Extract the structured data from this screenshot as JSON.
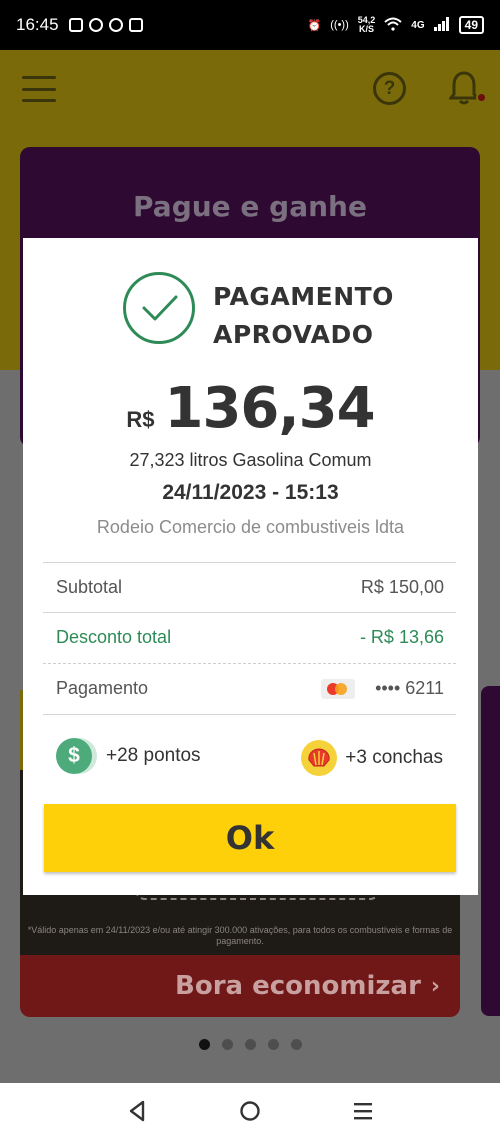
{
  "status_bar": {
    "time": "16:45",
    "net_speed_value": "54,2",
    "net_speed_unit": "K/S",
    "network": "4G",
    "battery": "49"
  },
  "background_app": {
    "promo_title": "Pague e ganhe",
    "disclaimer": "*Válido apenas em 24/11/2023 e/ou até atingir 300.000 ativações, para todos os combustíveis e formas de pagamento.",
    "cta_label": "Bora economizar",
    "carousel_pages": 5,
    "carousel_active": 0
  },
  "receipt": {
    "title_line1": "PAGAMENTO",
    "title_line2": "APROVADO",
    "currency": "R$",
    "amount": "136,34",
    "liters": "27,323 litros Gasolina Comum",
    "datetime": "24/11/2023 - 15:13",
    "merchant": "Rodeio Comercio de combustiveis ldta",
    "subtotal_label": "Subtotal",
    "subtotal_value": "R$ 150,00",
    "discount_label": "Desconto total",
    "discount_value": "- R$ 13,66",
    "payment_label": "Pagamento",
    "card_masked": "•••• 6211",
    "points": "+28 pontos",
    "shells": "+3 conchas",
    "ok_label": "Ok"
  },
  "colors": {
    "brand_yellow": "#fdd00a",
    "success_green": "#2e8b57",
    "promo_purple": "#2e0a33",
    "cta_red": "#701818"
  }
}
